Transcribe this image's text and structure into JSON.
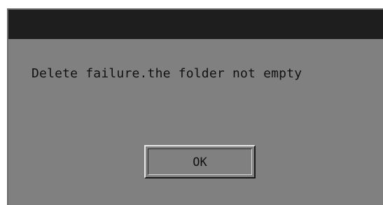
{
  "dialog": {
    "title": "",
    "message": "Delete failure.the folder not empty",
    "ok_label": "OK"
  },
  "colors": {
    "titlebar": "#1e1e1e",
    "dialog_background": "#808080",
    "text": "#111111"
  }
}
